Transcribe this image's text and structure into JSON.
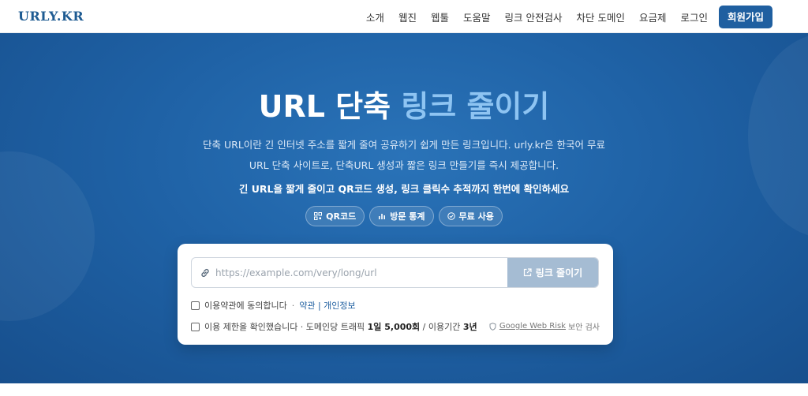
{
  "header": {
    "logo": "URLY.KR",
    "nav": [
      "소개",
      "웹진",
      "웹툴",
      "도움말",
      "링크 안전검사",
      "차단 도메인",
      "요금제",
      "로그인"
    ],
    "signup": "회원가입"
  },
  "hero": {
    "title_main": "URL 단축 ",
    "title_accent": "링크 줄이기",
    "desc_line1": "단축 URL이란 긴 인터넷 주소를 짧게 줄여 공유하기 쉽게 만든 링크입니다. urly.kr은 한국어 무료",
    "desc_line2": "URL 단축 사이트로, 단축URL 생성과 짧은 링크 만들기를 즉시 제공합니다.",
    "desc_line3": "긴 URL을 짧게 줄이고 QR코드 생성, 링크 클릭수 추적까지 한번에 확인하세요",
    "badges": [
      "QR코드",
      "방문 통계",
      "무료 사용"
    ]
  },
  "form": {
    "url_placeholder": "https://example.com/very/long/url",
    "url_value": "",
    "submit_label": "링크 줄이기",
    "terms_text": "이용약관에 동의합니다",
    "terms_link": "약관",
    "privacy_link": "개인정보",
    "limit_text": "이용 제한을 확인했습니다 · 도메인당 트래픽",
    "limit_traffic": "1일 5,000회",
    "limit_period_label": "/ 이용기간",
    "limit_period": "3년",
    "safety_link": "Google Web Risk",
    "safety_suffix": "보안 검사"
  },
  "colors": {
    "brand": "#1f5fa0",
    "hero_bg": "#1f62a6",
    "accent": "#8ec4f2",
    "button_disabled": "#a5bcd3"
  }
}
